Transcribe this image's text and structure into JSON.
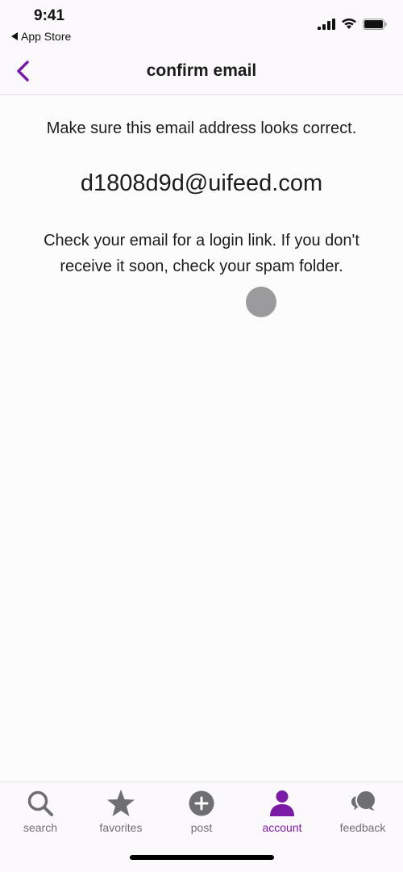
{
  "status_bar": {
    "time": "9:41",
    "back_app": "App Store",
    "icons": [
      "cellular-signal-icon",
      "wifi-icon",
      "battery-icon"
    ]
  },
  "nav": {
    "title": "confirm email",
    "back_icon": "chevron-left-icon"
  },
  "content": {
    "instruction": "Make sure this email address looks correct.",
    "email": "d1808d9d@uifeed.com",
    "info": "Check your email for a login link. If you don't receive it soon, check your spam folder."
  },
  "tabs": [
    {
      "label": "search",
      "icon": "search-icon",
      "active": false
    },
    {
      "label": "favorites",
      "icon": "star-icon",
      "active": false
    },
    {
      "label": "post",
      "icon": "plus-circle-icon",
      "active": false
    },
    {
      "label": "account",
      "icon": "person-icon",
      "active": true
    },
    {
      "label": "feedback",
      "icon": "chat-bubbles-icon",
      "active": false
    }
  ],
  "colors": {
    "accent": "#7a1aa6",
    "inactive": "#6f6e70",
    "text": "#1c1c1c"
  }
}
